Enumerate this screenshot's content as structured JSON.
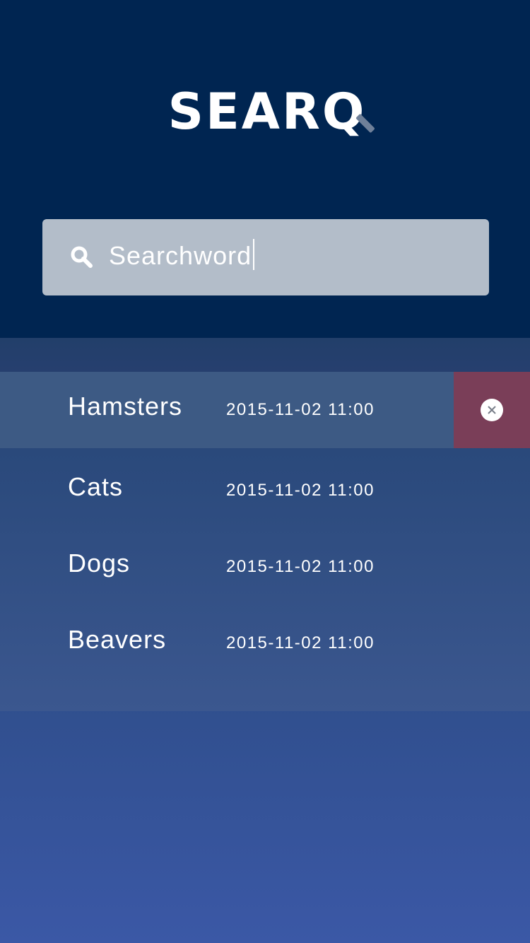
{
  "app": {
    "logo_text": "SEARQ"
  },
  "search": {
    "value": "Searchword",
    "icon": "search-icon"
  },
  "results": {
    "items": [
      {
        "title": "Hamsters",
        "date": "2015-11-02 11:00",
        "selected": true
      },
      {
        "title": "Cats",
        "date": "2015-11-02 11:00",
        "selected": false
      },
      {
        "title": "Dogs",
        "date": "2015-11-02 11:00",
        "selected": false
      },
      {
        "title": "Beavers",
        "date": "2015-11-02 11:00",
        "selected": false
      }
    ],
    "delete_icon": "close-circle-icon"
  },
  "colors": {
    "header_bg": "#002551",
    "search_box_bg": "#b3bdc9",
    "selected_row_bg": "#3d5a84",
    "delete_bg": "#7a3e58",
    "bottom_gradient_end": "#3b58a6"
  }
}
